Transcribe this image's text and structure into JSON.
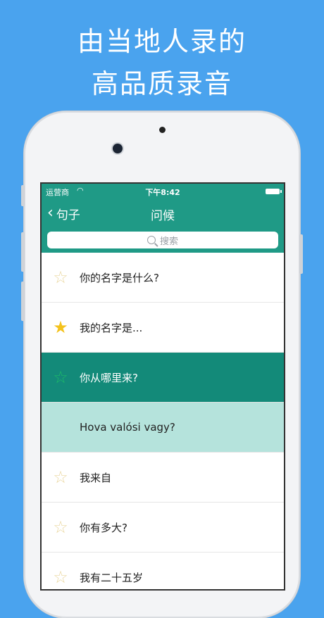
{
  "promo": {
    "line1": "由当地人录的",
    "line2": "高品质录音"
  },
  "status": {
    "carrier": "运营商",
    "time": "下午8:42"
  },
  "nav": {
    "back_label": "句子",
    "title": "问候"
  },
  "search": {
    "placeholder": "搜索"
  },
  "rows": [
    {
      "text": "你的名字是什么?",
      "starred": false
    },
    {
      "text": "我的名字是...",
      "starred": true
    },
    {
      "text": "你从哪里来?",
      "starred": false,
      "selected": true
    },
    {
      "text": "Hova valósi vagy?",
      "translation": true
    },
    {
      "text": "我来自",
      "starred": false
    },
    {
      "text": "你有多大?",
      "starred": false
    },
    {
      "text": "我有二十五岁",
      "starred": false
    }
  ],
  "colors": {
    "background": "#4aa3ee",
    "header": "#1f9a86",
    "selected_row": "#138a79",
    "translation_row": "#b5e3dc",
    "star_filled": "#f4c21c"
  }
}
